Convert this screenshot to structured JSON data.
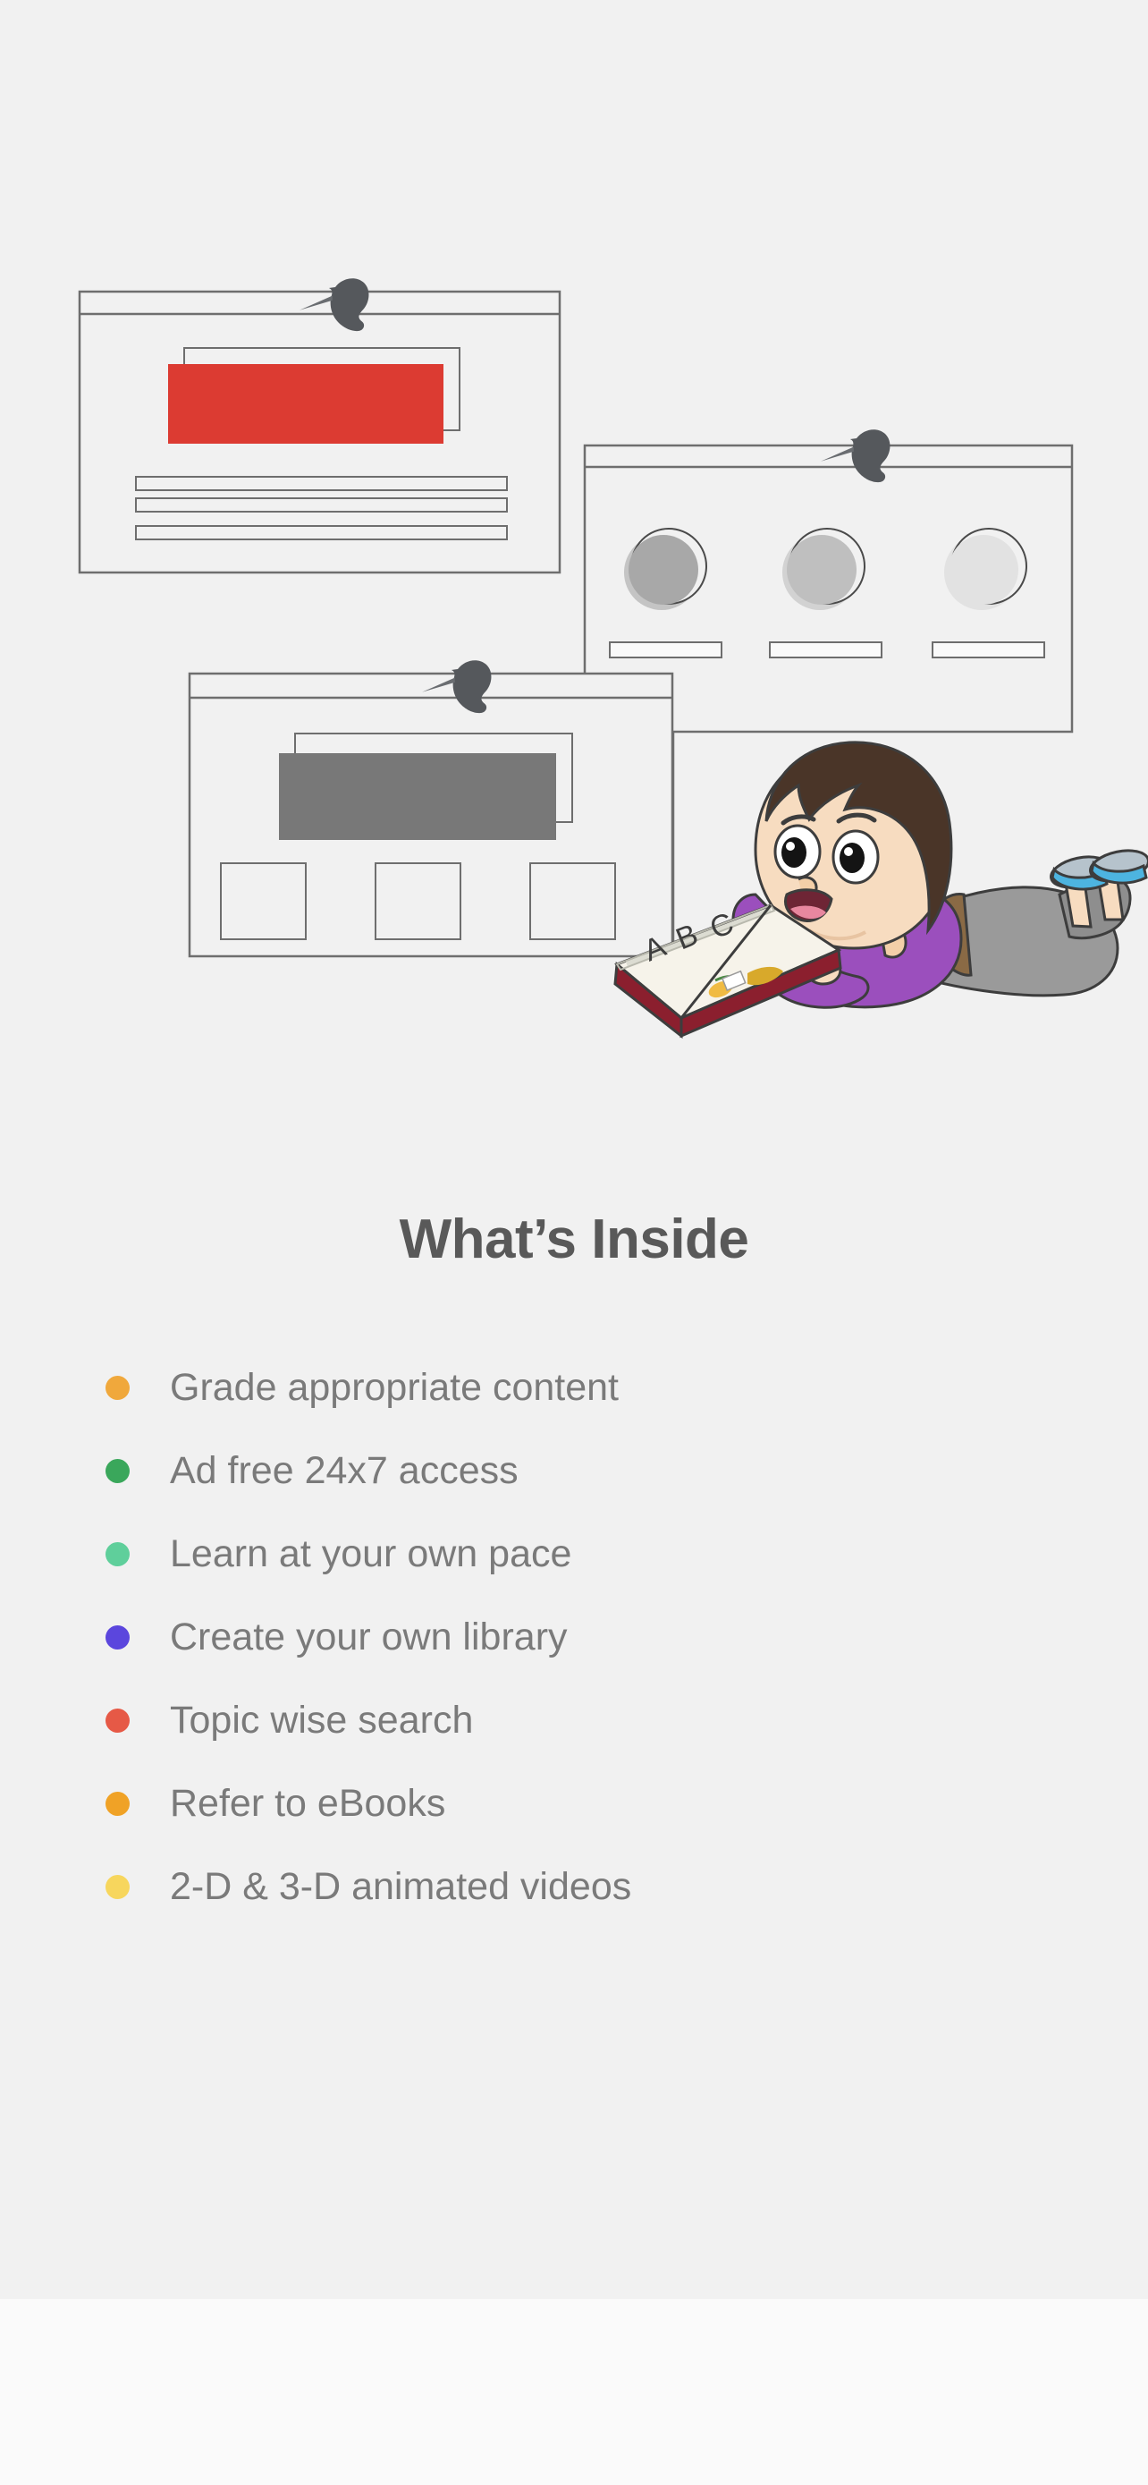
{
  "page": {
    "background_color": "#f1f1f1",
    "bottom_band_color": "#fafafa"
  },
  "illustration": {
    "name": "pinned-cards-with-reading-child",
    "outline_color": "#6e6e6e",
    "cards": [
      {
        "name": "card-text-article",
        "pin": "pushpin-icon",
        "accent_color": "#dc3b32",
        "elements": [
          "title-bar",
          "outlined-rect",
          "filled-rect",
          "line-1",
          "line-2",
          "line-3"
        ]
      },
      {
        "name": "card-avatars",
        "pin": "pushpin-icon",
        "elements": [
          "title-bar",
          "circle-1",
          "circle-2",
          "circle-3",
          "caption-1",
          "caption-2",
          "caption-3"
        ],
        "circle_shades": [
          "#a8a8a8",
          "#bfbfbf",
          "#e2e2e2"
        ]
      },
      {
        "name": "card-gallery",
        "pin": "pushpin-icon",
        "accent_color": "#787878",
        "elements": [
          "title-bar",
          "outlined-rect",
          "filled-rect",
          "thumb-1",
          "thumb-2",
          "thumb-3"
        ]
      }
    ],
    "character": {
      "name": "child-reading-book",
      "hair_color": "#4a3528",
      "skin_color": "#f7dcc0",
      "shirt_color": "#9b4fbd",
      "pants_color": "#9a9a9a",
      "shoe_color": "#4db4e0",
      "book_cover_color": "#8b1f2e",
      "book_letters": "ABC"
    }
  },
  "heading": {
    "title": "What’s Inside",
    "color": "#595959"
  },
  "features": {
    "text_color": "#7a7a7a",
    "items": [
      {
        "label": "Grade appropriate content",
        "bullet_color": "#f0a83c"
      },
      {
        "label": "Ad free 24x7 access",
        "bullet_color": "#3aa75b"
      },
      {
        "label": "Learn at your own pace",
        "bullet_color": "#5fcf9b"
      },
      {
        "label": "Create your own library",
        "bullet_color": "#5b46dd"
      },
      {
        "label": "Topic wise search",
        "bullet_color": "#e65946"
      },
      {
        "label": "Refer to eBooks",
        "bullet_color": "#f0a226"
      },
      {
        "label": "2-D & 3-D animated videos",
        "bullet_color": "#f7d65d"
      }
    ]
  }
}
